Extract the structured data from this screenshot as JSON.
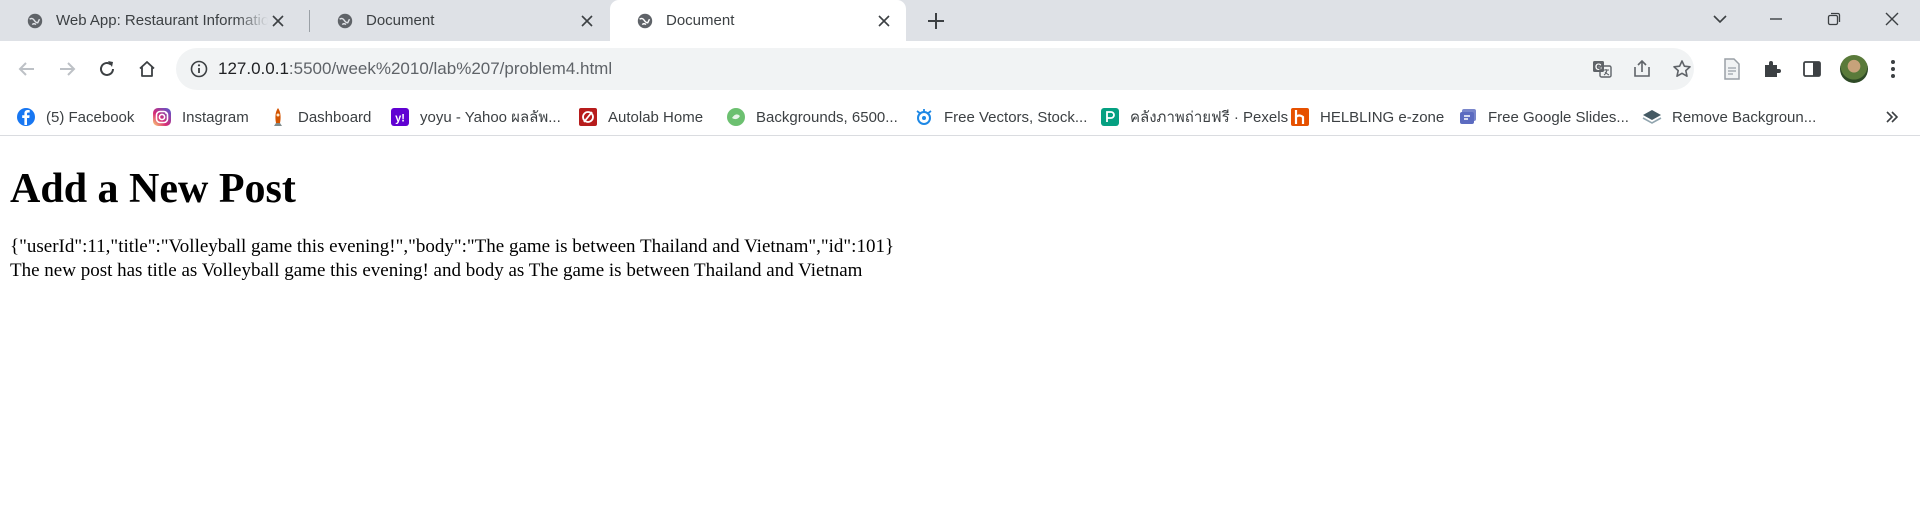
{
  "browser": {
    "tabs": [
      {
        "title": "Web App: Restaurant Information",
        "active": false
      },
      {
        "title": "Document",
        "active": false
      },
      {
        "title": "Document",
        "active": true
      }
    ],
    "address": {
      "host": "127.0.0.1",
      "path": ":5500/week%2010/lab%207/problem4.html"
    },
    "bookmarks": [
      {
        "label": "(5) Facebook",
        "icon": "facebook-icon",
        "color": "#1877f2"
      },
      {
        "label": "Instagram",
        "icon": "instagram-icon",
        "color": "#e1306c"
      },
      {
        "label": "Dashboard",
        "icon": "rocket-icon",
        "color": "#c0392b"
      },
      {
        "label": "yoyu - Yahoo ผลลัพ...",
        "icon": "yahoo-icon",
        "color": "#6001d2"
      },
      {
        "label": "Autolab Home",
        "icon": "autolab-icon",
        "color": "#b71c1c"
      },
      {
        "label": "Backgrounds, 6500...",
        "icon": "backgrounds-icon",
        "color": "#6cc070"
      },
      {
        "label": "Free Vectors, Stock...",
        "icon": "vectors-icon",
        "color": "#1e88e5"
      },
      {
        "label": "คลังภาพถ่ายฟรี · Pexels",
        "icon": "pexels-icon",
        "color": "#05a081"
      },
      {
        "label": "HELBLING e-zone",
        "icon": "helbling-icon",
        "color": "#e65100"
      },
      {
        "label": "Free Google Slides...",
        "icon": "slides-icon",
        "color": "#5c6bc0"
      },
      {
        "label": "Remove Backgroun...",
        "icon": "removebg-icon",
        "color": "#455a64"
      }
    ]
  },
  "page": {
    "heading": "Add a New Post",
    "json_line": "{\"userId\":11,\"title\":\"Volleyball game this evening!\",\"body\":\"The game is between Thailand and Vietnam\",\"id\":101}",
    "summary_line": "The new post has title as Volleyball game this evening! and body as The game is between Thailand and Vietnam"
  }
}
